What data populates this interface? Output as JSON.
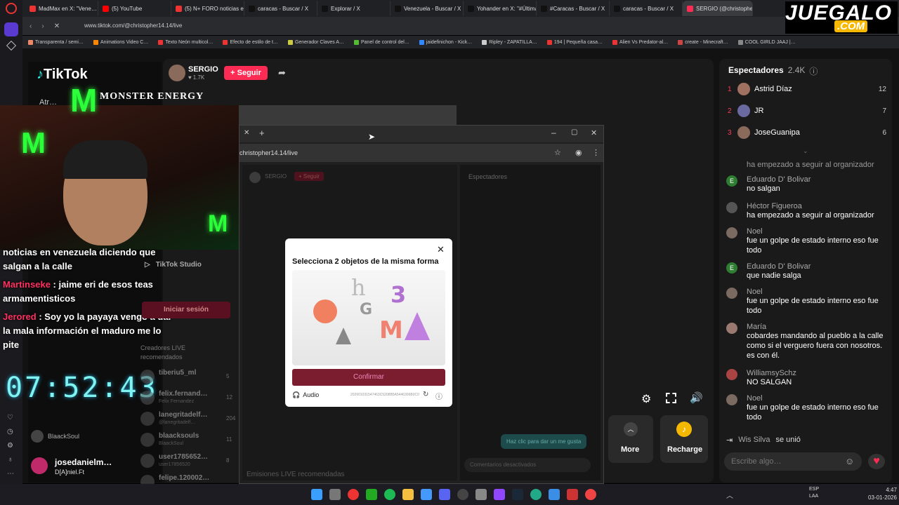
{
  "tabs": [
    "MadMax en X: \"Vene…",
    "(5) YouTube",
    "(5) N+ FORO noticias en v…",
    "caracas - Buscar / X",
    "Explorar / X",
    "Venezuela - Buscar / X",
    "Yohander en X: \"#Última…",
    "#Caracas - Buscar / X",
    "caracas - Buscar / X",
    "SERGIO (@christopher14…"
  ],
  "url": "www.tiktok.com/@christopher14.14/live",
  "bookmarks": [
    "Transparenta / semi…",
    "Animations Video C…",
    "Texto Neón multicol…",
    "Efecto de estilo de t…",
    "Generador Claves A…",
    "Panel de control del…",
    "jaidefinichon - Kick…",
    "Ripley - ZAPATILLA…",
    "194 | Pequeña casa…",
    "Alien Vs Predator-al…",
    "create - Minecraft…",
    "COOL GIRLD JAAJ |…"
  ],
  "watermark": {
    "word": "JUEGALO",
    "sub": ".COM"
  },
  "tiktok": {
    "brand": "TikTok",
    "back": "Atr…"
  },
  "sponsor": "MONSTER ENERGY",
  "streamer": {
    "name": "SERGIO",
    "likes": "1.7K",
    "follow": "+ Seguir"
  },
  "overlay_chat": [
    {
      "user": "",
      "text": "noticias en venezuela diciendo que salgan a la calle"
    },
    {
      "user": "Martinseke",
      "text": ": jaime eri de esos teas armamentisticos"
    },
    {
      "user": "Jerored",
      "text": ": Soy yo la payaya vengo a dar la mala información el maduro me lo pite"
    }
  ],
  "clock": "07:52:43",
  "left_panel": {
    "studio": "TikTok Studio",
    "login": "Iniciar sesión",
    "creators": "Creadores LIVE recomendados"
  },
  "creators": [
    {
      "name": "tiberiu5_ml",
      "count": "5"
    },
    {
      "name": "felix.fernand…",
      "sub": "Felix Fernandez",
      "count": "12"
    },
    {
      "name": "lanegritadelf…",
      "sub": "@lanegritadelf…",
      "count": "204"
    },
    {
      "name": "blaacksouls",
      "sub": "BlaackSoul",
      "count": "11"
    },
    {
      "name": "user1785652…",
      "sub": "user17856520",
      "count": "8"
    },
    {
      "name": "felipe.120002…",
      "count": ""
    }
  ],
  "lower_left": {
    "name": "blaacksouls",
    "sub": "BlaackSoul",
    "host": "josedanielm…",
    "host_sub": "D[A]niel.Ft"
  },
  "popup": {
    "url": "christopher14.14/live",
    "streamer": "SERGIO",
    "follow": "+ Seguir",
    "spectators": "Espectadores",
    "like_hint": "Haz clic para dar un me gusta",
    "comments_off": "Comentarios desactivados",
    "recommended": "Emisiones LIVE recomendadas"
  },
  "captcha": {
    "title": "Selecciona 2 objetos de la misma forma",
    "confirm": "Confirmar",
    "audio": "Audio",
    "code": "202601031547463C5208B5A5446306B0C0"
  },
  "controls": {
    "more": "More",
    "recharge": "Recharge"
  },
  "spectators": {
    "title": "Espectadores",
    "count": "2.4K"
  },
  "top_viewers": [
    {
      "rank": "1",
      "name": "Astrid Díaz",
      "score": "12",
      "color": "#a07060"
    },
    {
      "rank": "2",
      "name": "JR",
      "score": "7",
      "color": "#6a6aa0"
    },
    {
      "rank": "3",
      "name": "JoseGuanipa",
      "score": "6",
      "color": "#8a6a5a"
    }
  ],
  "comments": [
    {
      "name": "",
      "text": "ha empezado a seguir al organizador",
      "initial": "",
      "color": ""
    },
    {
      "name": "Eduardo D' Bolivar",
      "text": "no salgan",
      "initial": "E",
      "color": "#2e7d32"
    },
    {
      "name": "Héctor Figueroa",
      "text": "ha empezado a seguir al organizador",
      "initial": "",
      "color": "#555"
    },
    {
      "name": "Noel",
      "text": "fue un golpe de estado interno eso fue todo",
      "initial": "",
      "color": "#7a6a60"
    },
    {
      "name": "Eduardo D' Bolivar",
      "text": "que nadie salga",
      "initial": "E",
      "color": "#2e7d32"
    },
    {
      "name": "Noel",
      "text": "fue un golpe de estado interno eso fue todo",
      "initial": "",
      "color": "#7a6a60"
    },
    {
      "name": "María",
      "text": "cobardes mandando al pueblo a la calle como si el verguero fuera con nosotros. es con él.",
      "initial": "",
      "color": "#9a7a70"
    },
    {
      "name": "WilliamsySchz",
      "text": "NO SALGAN",
      "initial": "",
      "color": "#aa4444"
    },
    {
      "name": "Noel",
      "text": "fue un golpe de estado interno eso fue todo",
      "initial": "",
      "color": "#7a6a60"
    }
  ],
  "join": {
    "name": "Wis Silva",
    "text": "se unió"
  },
  "comment_input": {
    "placeholder": "Escribe algo…"
  },
  "taskbar": {
    "lang": "ESP",
    "lang2": "LAA",
    "time": "4:47",
    "date": "03-01-2026"
  }
}
